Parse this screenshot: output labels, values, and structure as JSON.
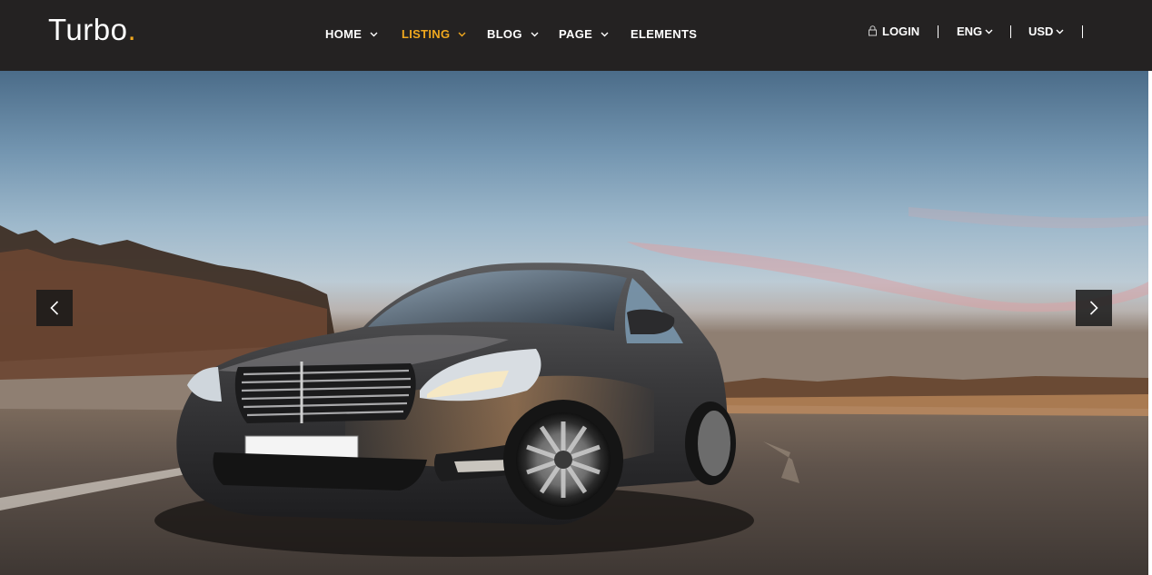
{
  "header": {
    "logo_text": "Turbo",
    "logo_dot": ".",
    "nav": [
      {
        "label": "HOME"
      },
      {
        "label": "LISTING"
      },
      {
        "label": "BLOG"
      },
      {
        "label": "PAGE"
      },
      {
        "label": "ELEMENTS"
      }
    ],
    "active_nav": "LISTING",
    "utility": {
      "login_label": "LOGIN",
      "language": "ENG",
      "currency": "USD"
    }
  },
  "hero": {
    "prev_icon": "chevron-left-icon",
    "next_icon": "chevron-right-icon"
  },
  "colors": {
    "accent": "#f0a81e",
    "topbar_bg": "#242222",
    "text": "#ffffff"
  }
}
